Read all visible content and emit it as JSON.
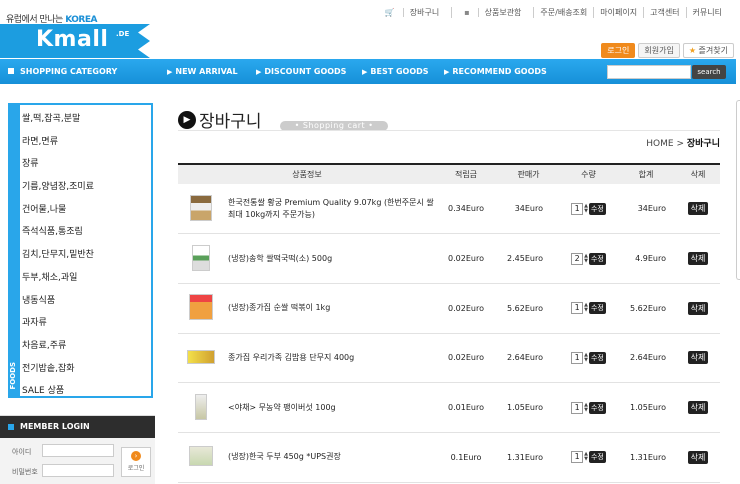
{
  "logo": {
    "tagline_kr": "유럽에서 만나는",
    "tagline_en": "KOREA",
    "name": "Kmall",
    "suffix": ".DE"
  },
  "top_links": [
    "장바구니",
    "상품보관함",
    "주문/배송조회",
    "마이페이지",
    "고객센터",
    "커뮤니티"
  ],
  "top_buttons": {
    "login": "로그인",
    "join": "회원가입",
    "favorite": "즐겨찾기"
  },
  "nav": {
    "category": "SHOPPING CATEGORY",
    "items": [
      "NEW ARRIVAL",
      "DISCOUNT GOODS",
      "BEST GOODS",
      "RECOMMEND GOODS"
    ],
    "search_button": "search"
  },
  "sidebar": {
    "label": "FOODS",
    "items": [
      "쌀,떡,잡곡,분말",
      "라면,면류",
      "장류",
      "기름,양념장,조미료",
      "건어물,나물",
      "즉석식품,통조림",
      "김치,단무지,밑반찬",
      "두부,채소,과일",
      "냉동식품",
      "과자류",
      "차음료,주류",
      "전기밥솥,잡화",
      "SALE 상품"
    ]
  },
  "member": {
    "title": "MEMBER LOGIN",
    "id_label": "아이디",
    "pw_label": "비밀번호",
    "login": "로그인"
  },
  "page": {
    "title": "장바구니",
    "subtitle": "Shopping cart",
    "breadcrumb_home": "HOME",
    "breadcrumb_sep": ">",
    "breadcrumb_current": "장바구니"
  },
  "table": {
    "headers": {
      "info": "상품정보",
      "points": "적립금",
      "price": "판매가",
      "qty": "수량",
      "total": "합계",
      "delete": "삭제"
    },
    "edit_label": "수정",
    "delete_label": "삭제",
    "rows": [
      {
        "name": "한국전통쌀 황궁 Premium Quality 9.07kg (한번주문시 쌀 최대 10kg까지 주문가능)",
        "points": "0.34Euro",
        "price": "34Euro",
        "qty": "1",
        "total": "34Euro"
      },
      {
        "name": "(냉장)송학 쌀떡국떡(소) 500g",
        "points": "0.02Euro",
        "price": "2.45Euro",
        "qty": "2",
        "total": "4.9Euro"
      },
      {
        "name": "(냉장)종가집 순쌀 떡볶이 1kg",
        "points": "0.02Euro",
        "price": "5.62Euro",
        "qty": "1",
        "total": "5.62Euro"
      },
      {
        "name": "종가집 우리가족 김밥용 단무지 400g",
        "points": "0.02Euro",
        "price": "2.64Euro",
        "qty": "1",
        "total": "2.64Euro"
      },
      {
        "name": "<야채> 무농약 팽이버섯 100g",
        "points": "0.01Euro",
        "price": "1.05Euro",
        "qty": "1",
        "total": "1.05Euro"
      },
      {
        "name": "(냉장)한국 두부 450g *UPS권장",
        "points": "0.1Euro",
        "price": "1.31Euro",
        "qty": "1",
        "total": "1.31Euro"
      }
    ]
  }
}
